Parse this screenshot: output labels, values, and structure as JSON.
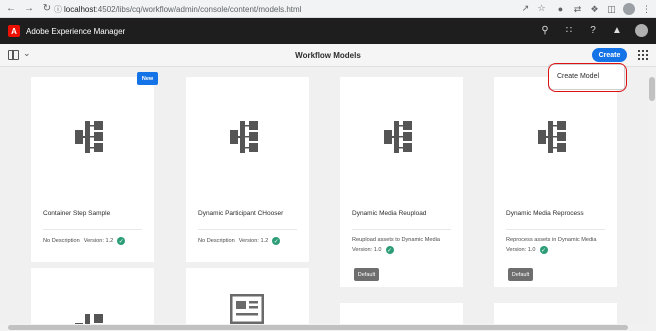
{
  "browser": {
    "url_host": "localhost",
    "url_path": ":4502/libs/cq/workflow/admin/console/content/models.html"
  },
  "shell": {
    "app_title": "Adobe Experience Manager"
  },
  "actionbar": {
    "page_title": "Workflow Models",
    "create_label": "Create"
  },
  "popover": {
    "create_model_label": "Create Model"
  },
  "cards": [
    {
      "title": "Container Step Sample",
      "description": "No Description",
      "version": "Version: 1.2",
      "badge": "New"
    },
    {
      "title": "Dynamic Participant CHooser",
      "description": "No Description",
      "version": "Version: 1.2"
    },
    {
      "title": "Dynamic Media Reupload",
      "description": "Reupload assets to Dynamic Media",
      "version": "Version: 1.0",
      "button": "Default"
    },
    {
      "title": "Dynamic Media Reprocess",
      "description": "Reprocess assets in Dynamic Media",
      "version": "Version: 1.0",
      "button": "Default"
    }
  ],
  "colors": {
    "accent": "#1473e6",
    "shell_bg": "#1e1e1e",
    "check": "#2d9d78",
    "highlight": "#dd1111"
  }
}
